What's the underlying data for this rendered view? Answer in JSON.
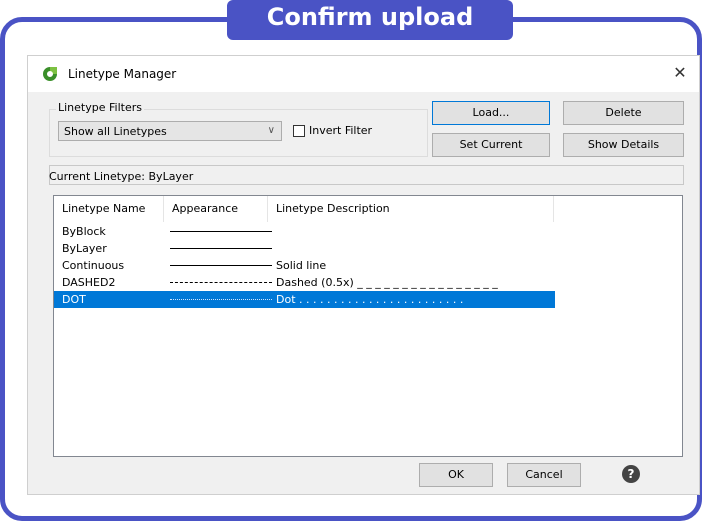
{
  "banner": {
    "title": "Confirm upload"
  },
  "dialog": {
    "title": "Linetype Manager",
    "icon": "app-logo-icon",
    "close_glyph": "✕",
    "filters": {
      "group_label": "Linetype Filters",
      "selected": "Show all Linetypes",
      "invert_label": "Invert Filter",
      "invert_checked": false
    },
    "buttons": {
      "load": "Load...",
      "delete": "Delete",
      "set_current": "Set Current",
      "show_details": "Show Details",
      "ok": "OK",
      "cancel": "Cancel"
    },
    "current_linetype": "Current Linetype: ByLayer",
    "list": {
      "columns": [
        "Linetype Name",
        "Appearance",
        "Linetype Description"
      ],
      "rows": [
        {
          "name": "ByBlock",
          "appearance": "solid",
          "description": ""
        },
        {
          "name": "ByLayer",
          "appearance": "solid",
          "description": ""
        },
        {
          "name": "Continuous",
          "appearance": "solid",
          "description": "Solid line"
        },
        {
          "name": "DASHED2",
          "appearance": "dashed",
          "description": "Dashed (0.5x) _ _ _ _ _ _ _ _ _ _ _ _ _ _ _ _"
        },
        {
          "name": "DOT",
          "appearance": "dotted",
          "description": "Dot . . . . . . . . . . . . . . . . . . . . . . . .",
          "selected": true
        }
      ]
    },
    "help_glyph": "?"
  },
  "colors": {
    "accent": "#4a53c5",
    "selection": "#0078d7"
  }
}
